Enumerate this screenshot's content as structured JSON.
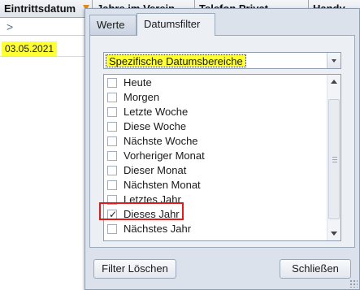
{
  "grid": {
    "columns": [
      "Eintrittsdatum",
      "Jahre im Verein",
      "Telefon Privat",
      "Handy"
    ],
    "filter_row_symbol": ">",
    "cell_value": "03.05.2021"
  },
  "popup": {
    "tabs": [
      "Werte",
      "Datumsfilter"
    ],
    "active_tab": "Datumsfilter",
    "combo": {
      "value": "Spezifische Datumsbereiche"
    },
    "items": [
      {
        "label": "Heute",
        "checked": false
      },
      {
        "label": "Morgen",
        "checked": false
      },
      {
        "label": "Letzte Woche",
        "checked": false
      },
      {
        "label": "Diese Woche",
        "checked": false
      },
      {
        "label": "Nächste Woche",
        "checked": false
      },
      {
        "label": "Vorheriger Monat",
        "checked": false
      },
      {
        "label": "Dieser Monat",
        "checked": false
      },
      {
        "label": "Nächsten Monat",
        "checked": false
      },
      {
        "label": "Letztes Jahr",
        "checked": false
      },
      {
        "label": "Dieses Jahr",
        "checked": true
      },
      {
        "label": "Nächstes Jahr",
        "checked": false
      }
    ],
    "buttons": {
      "clear": "Filter Löschen",
      "close": "Schließen"
    }
  },
  "colors": {
    "highlight": "#ffff35",
    "focus_box": "#e21a1a",
    "filter_icon": "#e08a1e"
  },
  "icons": [
    "filter-icon",
    "chevron-right-icon",
    "dropdown-arrow-icon",
    "scroll-up-icon",
    "scroll-down-icon",
    "resize-grip-icon"
  ]
}
